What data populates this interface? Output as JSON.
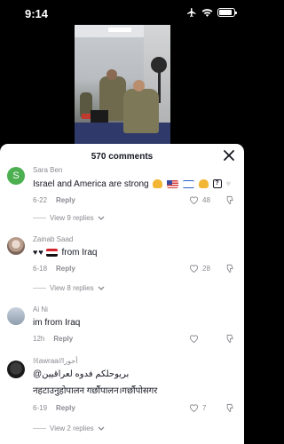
{
  "status_bar": {
    "time": "9:14"
  },
  "comments_header": {
    "count_label": "570 comments"
  },
  "comments": [
    {
      "username": "Sara Ben",
      "avatar_initial": "S",
      "avatar_color": "#4caf50",
      "text": "Israel and America are strong",
      "emojis": [
        "flexed-biceps",
        "us-flag",
        "israel-flag",
        "flexed-biceps",
        "unknown-glyph",
        "white-heart"
      ],
      "date": "6-22",
      "reply_label": "Reply",
      "likes": "48",
      "view_replies": "View 9 replies"
    },
    {
      "username": "Zainab Saad",
      "text_prefix_emojis": [
        "black-heart",
        "black-heart",
        "iraq-flag"
      ],
      "text": "from Iraq",
      "date": "6-18",
      "reply_label": "Reply",
      "likes": "28",
      "view_replies": "View 8 replies"
    },
    {
      "username": "Ai Ni",
      "text": "im from Iraq",
      "date": "12h",
      "reply_label": "Reply",
      "likes": "0"
    },
    {
      "username": "ℍawraa//أحورا",
      "text_line1": "@بريوحلكم فدوه لعراقيين",
      "text_line2": "नहटाउनुहोपालन गर्छौपालन।गर्छौपोसगर",
      "date": "6-19",
      "reply_label": "Reply",
      "likes": "7",
      "view_replies": "View 2 replies"
    }
  ]
}
